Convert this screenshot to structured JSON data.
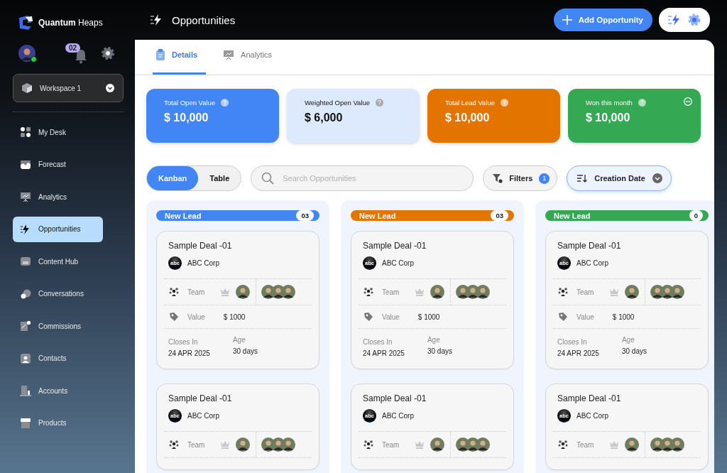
{
  "sidebar": {
    "brand": "**Quantum** Heaps",
    "user": {
      "online": true
    },
    "notification_count": "02",
    "workspace": "Workspace 1",
    "nav": [
      {
        "label": "My Desk",
        "selected": false
      },
      {
        "label": "Forecast",
        "selected": false
      },
      {
        "label": "Analytics",
        "selected": false
      },
      {
        "label": "Opportunities",
        "selected": true
      },
      {
        "label": "Content Hub",
        "selected": false
      },
      {
        "label": "Conversations",
        "selected": false
      },
      {
        "label": "Commissions",
        "selected": false
      },
      {
        "label": "Contacts",
        "selected": false
      },
      {
        "label": "Accounts",
        "selected": false
      },
      {
        "label": "Products",
        "selected": false
      }
    ]
  },
  "header": {
    "title": "Opportunities",
    "primary_button": "Add Opportunity"
  },
  "tabs": [
    {
      "label": "Details",
      "selected": true
    },
    {
      "label": "Analytics",
      "selected": false
    }
  ],
  "stats": [
    {
      "label": "Total Open Value",
      "value": "$ 10,000",
      "color": "#4285f4",
      "more_menu": false
    },
    {
      "label": "Weighted Open Value",
      "value": "$ 6,000",
      "color": "#dde9fd",
      "more_menu": false
    },
    {
      "label": "Total Lead Value",
      "value": "$ 10,000",
      "color": "#e37400",
      "more_menu": false
    },
    {
      "label": "Won this month",
      "value": "$ 10,000",
      "color": "#34a853",
      "more_menu": true
    }
  ],
  "view_toggle": [
    {
      "label": "Kanban",
      "selected": true
    },
    {
      "label": "Table",
      "selected": false
    }
  ],
  "search": {
    "placeholder": "Search Opportunities"
  },
  "filters": {
    "label": "Filters",
    "count": "1"
  },
  "sort": {
    "label": "Creation Date"
  },
  "columns": [
    {
      "title": "New Lead",
      "count": "03",
      "color": "#4285f4",
      "cards": [
        {
          "title": "Sample Deal -01",
          "logo_text": "abc",
          "company": "ABC Corp",
          "team_label": "Team",
          "value_label": "Value",
          "value": "$ 1000",
          "closes_label": "Closes In",
          "closes": "24 APR 2025",
          "age_label": "Age",
          "age": "30 days"
        },
        {
          "title": "Sample Deal -01",
          "logo_text": "abc",
          "company": "ABC Corp",
          "team_label": "Team"
        }
      ]
    },
    {
      "title": "New Lead",
      "count": "03",
      "color": "#e37400",
      "cards": [
        {
          "title": "Sample Deal -01",
          "logo_text": "abc",
          "company": "ABC Corp",
          "team_label": "Team",
          "value_label": "Value",
          "value": "$ 1000",
          "closes_label": "Closes In",
          "closes": "24 APR 2025",
          "age_label": "Age",
          "age": "30 days"
        },
        {
          "title": "Sample Deal -01",
          "logo_text": "abc",
          "company": "ABC Corp",
          "team_label": "Team"
        }
      ]
    },
    {
      "title": "New Lead",
      "count": "0",
      "color": "#34a853",
      "cards": [
        {
          "title": "Sample Deal -01",
          "logo_text": "abc",
          "company": "ABC Corp",
          "team_label": "Team",
          "value_label": "Value",
          "value": "$ 1000",
          "closes_label": "Closes In",
          "closes": "24 APR 2025",
          "age_label": "Age",
          "age": "30 days"
        },
        {
          "title": "Sample Deal -01",
          "logo_text": "abc",
          "company": "ABC Corp",
          "team_label": "Team"
        }
      ]
    }
  ]
}
